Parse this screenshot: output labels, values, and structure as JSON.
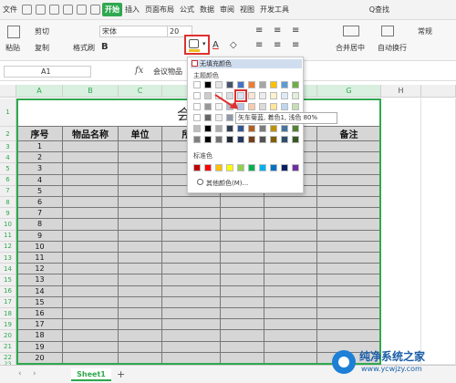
{
  "menubar": {
    "file": "文件",
    "tabs": [
      "开始",
      "插入",
      "页面布局",
      "公式",
      "数据",
      "审阅",
      "视图",
      "开发工具"
    ],
    "search": "Q查找"
  },
  "ribbon": {
    "paste": "粘贴",
    "cut": "剪切",
    "copy": "复制",
    "format_painter": "格式刷",
    "font_name": "宋体",
    "font_size": "20",
    "bold": "B",
    "merge": "合并居中",
    "wrap": "自动换行",
    "normal": "常规"
  },
  "formula": {
    "cell_ref": "A1",
    "fx": "fx",
    "value": "会议物品"
  },
  "columns": [
    "A",
    "B",
    "C",
    "D",
    "E",
    "F",
    "G",
    "H"
  ],
  "rows": [
    "1",
    "2",
    "3",
    "4",
    "5",
    "6",
    "7",
    "8",
    "9",
    "10",
    "11",
    "12",
    "13",
    "14",
    "15",
    "16",
    "17",
    "18",
    "19",
    "20",
    "21",
    "22",
    "23"
  ],
  "sheet": {
    "title": "会议物",
    "headers": [
      "序号",
      "物品名称",
      "单位",
      "所需",
      "",
      "齐",
      "备注"
    ],
    "numbers": [
      "1",
      "2",
      "3",
      "4",
      "5",
      "6",
      "7",
      "8",
      "9",
      "10",
      "11",
      "12",
      "13",
      "14",
      "15",
      "16",
      "17",
      "18",
      "19",
      "20"
    ]
  },
  "dropdown": {
    "no_fill": "无填充颜色",
    "theme_label": "主题颜色",
    "standard_label": "标准色",
    "more_colors": "其他颜色(M)...",
    "tooltip": "矢车菊蓝, 着色1, 浅色 80%",
    "theme_top": [
      "#ffffff",
      "#000000",
      "#e7e6e6",
      "#44546a",
      "#4472c4",
      "#ed7d31",
      "#a5a5a5",
      "#ffc000",
      "#5b9bd5",
      "#70ad47"
    ],
    "standard": [
      "#c00000",
      "#ff0000",
      "#ffc000",
      "#ffff00",
      "#92d050",
      "#00b050",
      "#00b0f0",
      "#0070c0",
      "#002060",
      "#7030a0"
    ]
  },
  "sheet_tab": "Sheet1",
  "watermark": {
    "title": "纯净系统之家",
    "url": "www.ycwjzy.com"
  }
}
